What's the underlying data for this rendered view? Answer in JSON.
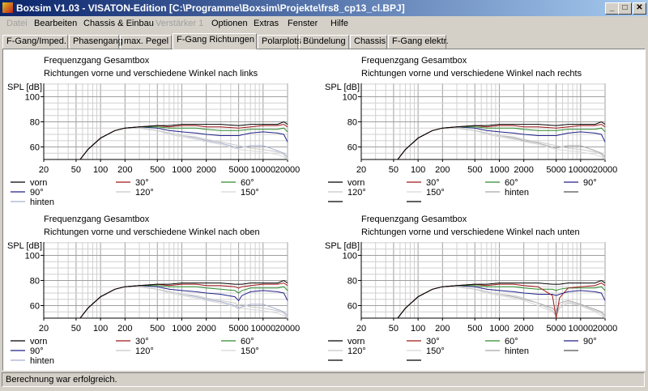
{
  "window": {
    "title": "Boxsim V1.03 - VISATON-Edition [C:\\Programme\\Boxsim\\Projekte\\frs8_cp13_cl.BPJ]",
    "minimize": "_",
    "maximize": "□",
    "close": "✕"
  },
  "menu": [
    {
      "label": "Datei",
      "enabled": false
    },
    {
      "label": "Bearbeiten",
      "enabled": true
    },
    {
      "label": "Chassis & Einbau",
      "enabled": true
    },
    {
      "label": "Verstärker 1",
      "enabled": false
    },
    {
      "label": "Optionen",
      "enabled": true
    },
    {
      "label": "Extras",
      "enabled": true
    },
    {
      "label": "Fenster",
      "enabled": true
    },
    {
      "label": "Hilfe",
      "enabled": true
    }
  ],
  "tabs": [
    {
      "label": "F-Gang/Imped."
    },
    {
      "label": "Phasengang"
    },
    {
      "label": "max. Pegel"
    },
    {
      "label": "F-Gang Richtungen",
      "active": true
    },
    {
      "label": "Polarplots"
    },
    {
      "label": "Bündelung"
    },
    {
      "label": "Chassis"
    },
    {
      "label": "F-Gang elektr."
    }
  ],
  "status": "Berechnung war erfolgreich.",
  "chart_data": [
    {
      "type": "line",
      "title": "Frequenzgang Gesamtbox",
      "subtitle": "Richtungen vorne und verschiedene Winkel nach links",
      "ylabel": "SPL [dB]",
      "xscale": "log",
      "xlim": [
        20,
        20000
      ],
      "ylim": [
        50,
        110.6
      ],
      "xticks": [
        20,
        50,
        100,
        200,
        500,
        1000,
        2000,
        5000,
        10000,
        20000
      ],
      "yticks": [
        60,
        80,
        100
      ],
      "grid": true,
      "legend_columns": 3,
      "x": [
        20,
        50,
        56,
        70,
        100,
        150,
        200,
        300,
        500,
        700,
        1000,
        1500,
        2000,
        3000,
        5000,
        7000,
        10000,
        15000,
        18000,
        20000
      ],
      "series": [
        {
          "name": "vorn",
          "color": "#000000",
          "values": [
            50,
            50,
            50,
            58,
            67,
            73,
            75,
            76,
            77,
            77,
            78,
            78,
            78,
            78,
            77,
            78,
            78,
            78,
            80,
            78
          ]
        },
        {
          "name": "30°",
          "color": "#a01818",
          "values": [
            50,
            50,
            50,
            58,
            67,
            73,
            75,
            76,
            77,
            76,
            77,
            77,
            76,
            76,
            75,
            76,
            77,
            77,
            78,
            76
          ]
        },
        {
          "name": "60°",
          "color": "#2e8a2e",
          "values": [
            50,
            50,
            50,
            58,
            67,
            73,
            75,
            76,
            76,
            75,
            75,
            75,
            74,
            73,
            73,
            74,
            74,
            74,
            75,
            72
          ]
        },
        {
          "name": "90°",
          "color": "#22228a",
          "values": [
            50,
            50,
            50,
            58,
            67,
            73,
            75,
            76,
            75,
            73,
            72,
            71,
            70,
            69,
            69,
            71,
            72,
            71,
            70,
            64
          ]
        },
        {
          "name": "120°",
          "color": "#c8c8c8",
          "values": [
            50,
            50,
            50,
            58,
            67,
            73,
            75,
            75,
            73,
            71,
            69,
            68,
            66,
            64,
            61,
            59,
            58,
            56,
            54,
            50
          ]
        },
        {
          "name": "150°",
          "color": "#d8d8d8",
          "values": [
            50,
            50,
            50,
            58,
            67,
            73,
            75,
            75,
            73,
            70,
            68,
            66,
            64,
            62,
            58,
            57,
            56,
            54,
            52,
            50
          ]
        },
        {
          "name": "hinten",
          "color": "#a8b0d0",
          "values": [
            50,
            50,
            50,
            58,
            67,
            73,
            75,
            75,
            73,
            71,
            69,
            67,
            65,
            63,
            59,
            61,
            61,
            57,
            55,
            52
          ]
        }
      ]
    },
    {
      "type": "line",
      "title": "Frequenzgang Gesamtbox",
      "subtitle": "Richtungen vorne und verschiedene Winkel nach rechts",
      "ylabel": "SPL [dB]",
      "xscale": "log",
      "xlim": [
        20,
        20000
      ],
      "ylim": [
        50,
        110.6
      ],
      "xticks": [
        20,
        50,
        100,
        200,
        500,
        1000,
        2000,
        5000,
        10000,
        20000
      ],
      "yticks": [
        60,
        80,
        100
      ],
      "grid": true,
      "legend_columns": 4,
      "x": [
        20,
        50,
        56,
        70,
        100,
        150,
        200,
        300,
        500,
        700,
        1000,
        1500,
        2000,
        3000,
        5000,
        7000,
        10000,
        15000,
        18000,
        20000
      ],
      "series": [
        {
          "name": "vorn",
          "color": "#000000",
          "values": [
            50,
            50,
            50,
            58,
            67,
            73,
            75,
            76,
            77,
            77,
            78,
            78,
            78,
            78,
            77,
            78,
            78,
            78,
            80,
            78
          ]
        },
        {
          "name": "30°",
          "color": "#a01818",
          "values": [
            50,
            50,
            50,
            58,
            67,
            73,
            75,
            76,
            77,
            76,
            77,
            77,
            76,
            76,
            75,
            76,
            77,
            77,
            78,
            76
          ]
        },
        {
          "name": "60°",
          "color": "#2e8a2e",
          "values": [
            50,
            50,
            50,
            58,
            67,
            73,
            75,
            76,
            76,
            75,
            75,
            75,
            74,
            73,
            73,
            74,
            74,
            74,
            75,
            72
          ]
        },
        {
          "name": "90°",
          "color": "#22228a",
          "values": [
            50,
            50,
            50,
            58,
            67,
            73,
            75,
            76,
            75,
            73,
            72,
            71,
            70,
            69,
            69,
            71,
            72,
            71,
            70,
            64
          ]
        },
        {
          "name": "120°",
          "color": "#c8c8c8",
          "values": [
            50,
            50,
            50,
            58,
            67,
            73,
            75,
            75,
            73,
            71,
            69,
            68,
            66,
            64,
            61,
            59,
            58,
            56,
            54,
            50
          ]
        },
        {
          "name": "150°",
          "color": "#d8d8d8",
          "values": [
            50,
            50,
            50,
            58,
            67,
            73,
            75,
            75,
            73,
            70,
            68,
            66,
            64,
            62,
            58,
            57,
            56,
            54,
            52,
            50
          ]
        },
        {
          "name": "hinten",
          "color": "#a8a8a8",
          "values": [
            50,
            50,
            50,
            58,
            67,
            73,
            75,
            75,
            73,
            71,
            69,
            67,
            65,
            63,
            59,
            61,
            61,
            57,
            55,
            52
          ]
        },
        {
          "name": "",
          "color": "#505050",
          "values": []
        },
        {
          "name": "",
          "color": "#000000",
          "values": []
        },
        {
          "name": "",
          "color": "#000000",
          "values": []
        }
      ]
    },
    {
      "type": "line",
      "title": "Frequenzgang Gesamtbox",
      "subtitle": "Richtungen vorne und verschiedene Winkel nach oben",
      "ylabel": "SPL [dB]",
      "xscale": "log",
      "xlim": [
        20,
        20000
      ],
      "ylim": [
        50,
        110.6
      ],
      "xticks": [
        20,
        50,
        100,
        200,
        500,
        1000,
        2000,
        5000,
        10000,
        20000
      ],
      "yticks": [
        60,
        80,
        100
      ],
      "grid": true,
      "legend_columns": 3,
      "x": [
        20,
        50,
        56,
        70,
        100,
        150,
        200,
        300,
        500,
        700,
        1000,
        1500,
        2000,
        3000,
        4500,
        5000,
        5500,
        7000,
        10000,
        15000,
        18000,
        20000
      ],
      "series": [
        {
          "name": "vorn",
          "color": "#000000",
          "values": [
            50,
            50,
            50,
            58,
            67,
            73,
            75,
            76,
            77,
            77,
            78,
            78,
            78,
            78,
            77,
            77,
            77,
            78,
            78,
            78,
            80,
            78
          ]
        },
        {
          "name": "30°",
          "color": "#a01818",
          "values": [
            50,
            50,
            50,
            58,
            67,
            73,
            75,
            76,
            77,
            76,
            77,
            77,
            76,
            76,
            75,
            74,
            75,
            76,
            77,
            77,
            78,
            76
          ]
        },
        {
          "name": "60°",
          "color": "#2e8a2e",
          "values": [
            50,
            50,
            50,
            58,
            67,
            73,
            75,
            76,
            76,
            75,
            75,
            75,
            74,
            73,
            72,
            70,
            72,
            74,
            74,
            74,
            75,
            72
          ]
        },
        {
          "name": "90°",
          "color": "#22228a",
          "values": [
            50,
            50,
            50,
            58,
            67,
            73,
            75,
            76,
            75,
            73,
            72,
            71,
            70,
            69,
            67,
            64,
            68,
            71,
            72,
            71,
            70,
            64
          ]
        },
        {
          "name": "120°",
          "color": "#c8c8c8",
          "values": [
            50,
            50,
            50,
            58,
            67,
            73,
            75,
            75,
            73,
            71,
            69,
            68,
            66,
            64,
            62,
            60,
            61,
            59,
            58,
            56,
            54,
            50
          ]
        },
        {
          "name": "150°",
          "color": "#d8d8d8",
          "values": [
            50,
            50,
            50,
            58,
            67,
            73,
            75,
            75,
            73,
            70,
            68,
            66,
            64,
            62,
            59,
            57,
            58,
            57,
            56,
            54,
            52,
            50
          ]
        },
        {
          "name": "hinten",
          "color": "#a8b0d0",
          "values": [
            50,
            50,
            50,
            58,
            67,
            73,
            75,
            75,
            73,
            71,
            69,
            67,
            65,
            63,
            60,
            58,
            59,
            61,
            61,
            57,
            55,
            52
          ]
        }
      ]
    },
    {
      "type": "line",
      "title": "Frequenzgang Gesamtbox",
      "subtitle": "Richtungen vorne und verschiedene Winkel nach unten",
      "ylabel": "SPL [dB]",
      "xscale": "log",
      "xlim": [
        20,
        20000
      ],
      "ylim": [
        50,
        110.6
      ],
      "xticks": [
        20,
        50,
        100,
        200,
        500,
        1000,
        2000,
        5000,
        10000,
        20000
      ],
      "yticks": [
        60,
        80,
        100
      ],
      "grid": true,
      "legend_columns": 4,
      "x": [
        20,
        50,
        56,
        70,
        100,
        150,
        200,
        300,
        500,
        700,
        1000,
        1500,
        2000,
        3000,
        4500,
        5000,
        5500,
        7000,
        10000,
        15000,
        18000,
        20000
      ],
      "series": [
        {
          "name": "vorn",
          "color": "#000000",
          "values": [
            50,
            50,
            50,
            58,
            67,
            73,
            75,
            76,
            77,
            77,
            78,
            78,
            78,
            78,
            77,
            77,
            77,
            78,
            78,
            78,
            80,
            78
          ]
        },
        {
          "name": "30°",
          "color": "#a01818",
          "values": [
            50,
            50,
            50,
            58,
            67,
            73,
            75,
            76,
            77,
            76,
            77,
            77,
            76,
            75,
            68,
            50,
            66,
            74,
            75,
            76,
            78,
            76
          ]
        },
        {
          "name": "60°",
          "color": "#2e8a2e",
          "values": [
            50,
            50,
            50,
            58,
            67,
            73,
            75,
            76,
            76,
            75,
            75,
            75,
            74,
            73,
            73,
            72,
            73,
            74,
            74,
            74,
            75,
            72
          ]
        },
        {
          "name": "90°",
          "color": "#22228a",
          "values": [
            50,
            50,
            50,
            58,
            67,
            73,
            75,
            76,
            75,
            73,
            72,
            71,
            70,
            69,
            69,
            68,
            69,
            71,
            72,
            71,
            70,
            64
          ]
        },
        {
          "name": "120°",
          "color": "#c8c8c8",
          "values": [
            50,
            50,
            50,
            58,
            67,
            73,
            75,
            75,
            73,
            71,
            69,
            68,
            66,
            62,
            56,
            52,
            58,
            62,
            60,
            56,
            54,
            50
          ]
        },
        {
          "name": "150°",
          "color": "#d8d8d8",
          "values": [
            50,
            50,
            50,
            58,
            67,
            73,
            75,
            75,
            73,
            70,
            68,
            66,
            64,
            60,
            55,
            52,
            60,
            63,
            60,
            55,
            52,
            50
          ]
        },
        {
          "name": "hinten",
          "color": "#a8a8a8",
          "values": [
            50,
            50,
            50,
            58,
            67,
            73,
            75,
            75,
            73,
            71,
            69,
            67,
            65,
            62,
            58,
            55,
            62,
            64,
            61,
            57,
            55,
            52
          ]
        },
        {
          "name": "",
          "color": "#505050",
          "values": []
        },
        {
          "name": "",
          "color": "#000000",
          "values": []
        },
        {
          "name": "",
          "color": "#000000",
          "values": []
        }
      ]
    }
  ]
}
